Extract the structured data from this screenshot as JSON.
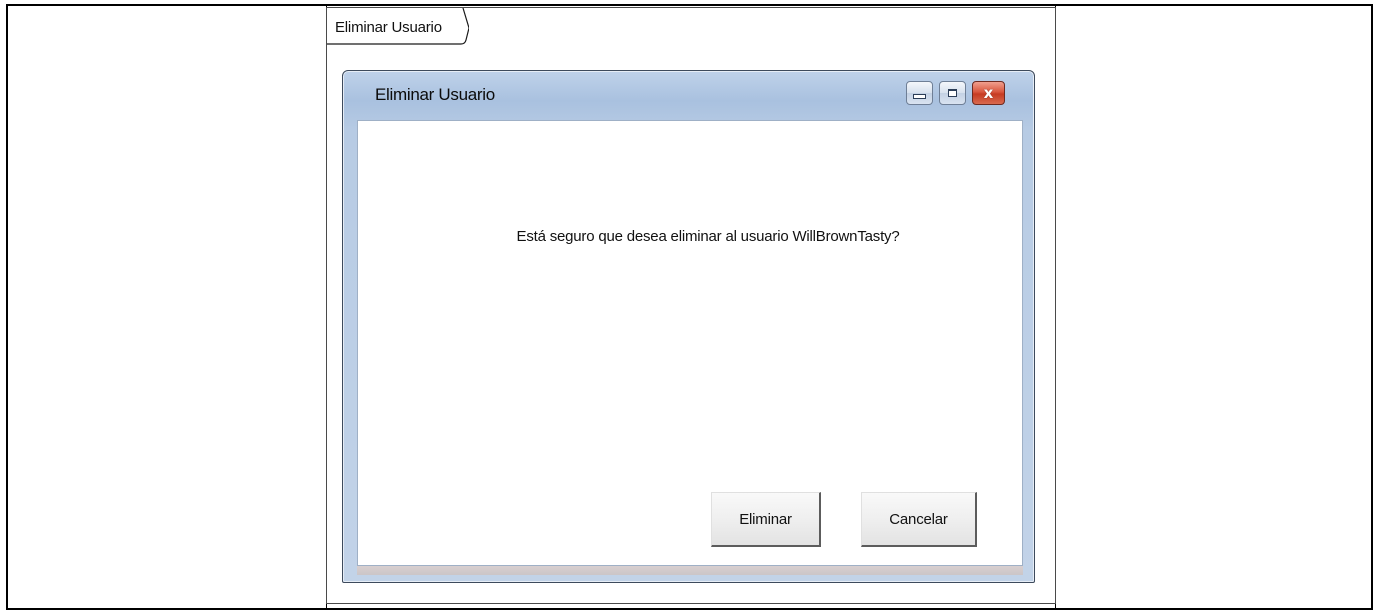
{
  "frame": {
    "tab_label": "Eliminar Usuario"
  },
  "window": {
    "title": "Eliminar Usuario",
    "controls": {
      "minimize_icon": "minimize-icon",
      "maximize_icon": "maximize-icon",
      "close_icon": "close-icon",
      "close_glyph": "x"
    }
  },
  "dialog": {
    "message": "Está seguro que desea eliminar al usuario WillBrownTasty?",
    "buttons": {
      "delete_label": "Eliminar",
      "cancel_label": "Cancelar"
    }
  },
  "colors": {
    "titlebar": "#a9c1df",
    "close_button": "#c63b22",
    "border": "#000000"
  }
}
